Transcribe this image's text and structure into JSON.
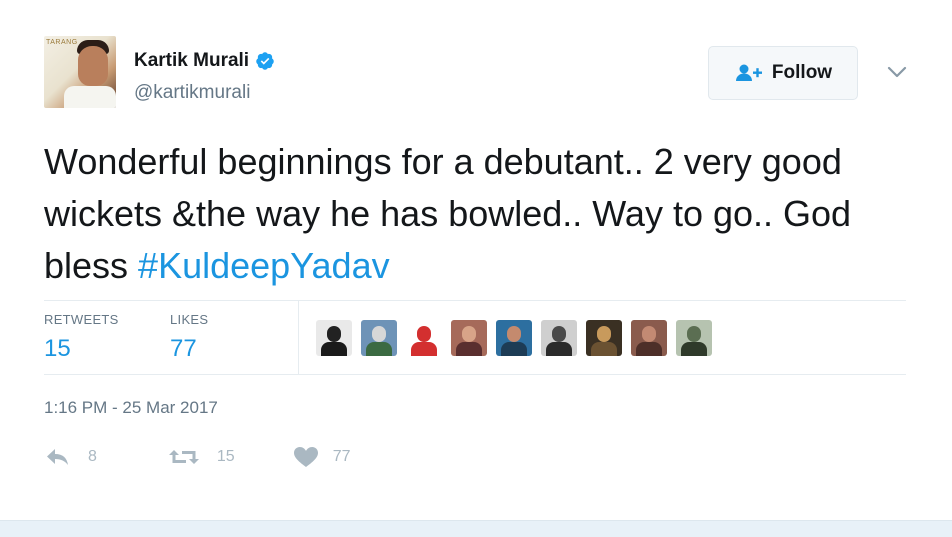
{
  "author": {
    "name": "Kartik Murali",
    "handle": "@kartikmurali",
    "avatar_text": "TARANG",
    "verified_icon": "verified-badge-icon"
  },
  "follow_button": {
    "label": "Follow",
    "icon": "add-user-icon"
  },
  "menu": {
    "icon": "chevron-down-icon"
  },
  "tweet": {
    "text": "Wonderful beginnings for a debutant.. 2 very good wickets &the way he has bowled.. Way to go.. God bless ",
    "hashtag": "#KuldeepYadav"
  },
  "stats": {
    "retweets_label": "RETWEETS",
    "retweets_value": "15",
    "likes_label": "LIKES",
    "likes_value": "77"
  },
  "likers": [
    {
      "name": "liker-1",
      "colors": [
        "#e9e9e9",
        "#222222",
        "#1a1a1a"
      ]
    },
    {
      "name": "liker-2",
      "colors": [
        "#6e93b7",
        "#d7d7d7",
        "#3b6a42"
      ]
    },
    {
      "name": "liker-3",
      "colors": [
        "#ffffff",
        "#d32f2f",
        "#d32f2f"
      ]
    },
    {
      "name": "liker-4",
      "colors": [
        "#a66a5a",
        "#d8a488",
        "#5a2f2f"
      ]
    },
    {
      "name": "liker-5",
      "colors": [
        "#2d6fa0",
        "#c48a6e",
        "#1d3c55"
      ]
    },
    {
      "name": "liker-6",
      "colors": [
        "#cfcfcf",
        "#4a4a4a",
        "#2b2b2b"
      ]
    },
    {
      "name": "liker-7",
      "colors": [
        "#3a3023",
        "#c89a5c",
        "#6b5232"
      ]
    },
    {
      "name": "liker-8",
      "colors": [
        "#8a5b4d",
        "#c38a73",
        "#4d2f29"
      ]
    },
    {
      "name": "liker-9",
      "colors": [
        "#b6c3b0",
        "#5b6e52",
        "#2f3a2a"
      ]
    }
  ],
  "timestamp": "1:16 PM - 25 Mar 2017",
  "actions": {
    "reply_count": "8",
    "retweet_count": "15",
    "like_count": "77"
  },
  "colors": {
    "link": "#1b95e0",
    "muted": "#657786",
    "icon": "#aab8c2",
    "verified": "#1da1f2"
  }
}
